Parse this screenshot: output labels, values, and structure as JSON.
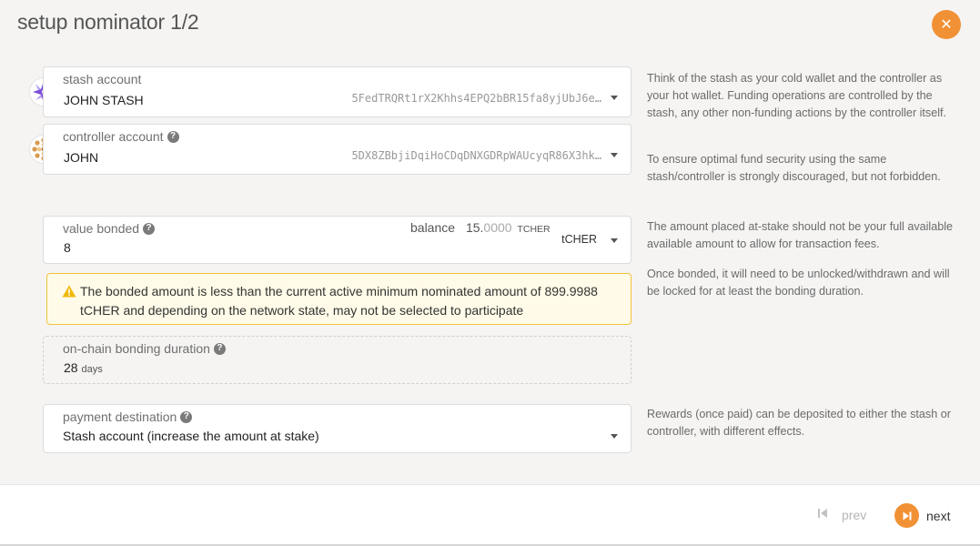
{
  "title": "setup nominator 1/2",
  "close_icon": "close-icon",
  "colors": {
    "accent": "#f19135",
    "warning_bg": "#fffbe8",
    "warning_border": "#f0c23a"
  },
  "stash": {
    "label": "stash account",
    "name": "JOHN STASH",
    "address": "5FedTRQRt1rX2Khhs4EPQ2bBR15fa8yjUbJ6e…"
  },
  "controller": {
    "label": "controller account",
    "name": "JOHN",
    "address": "5DX8ZBbjiDqiHoCDqDNXGDRpWAUcyqR86X3hk…"
  },
  "help": {
    "stash_p1": "Think of the stash as your cold wallet and the controller as your hot wallet. Funding operations are controlled by the stash, any other non-funding actions by the controller itself.",
    "stash_p2": "To ensure optimal fund security using the same stash/controller is strongly discouraged, but not forbidden.",
    "value_p1": "The amount placed at-stake should not be your full available available amount to allow for transaction fees.",
    "value_p2": "Once bonded, it will need to be unlocked/withdrawn and will be locked for at least the bonding duration.",
    "payment_p1": "Rewards (once paid) can be deposited to either the stash or controller, with different effects."
  },
  "value_bonded": {
    "label": "value bonded",
    "value": "8",
    "balance_label": "balance",
    "balance_int": "15.",
    "balance_dec": "0000",
    "balance_unit": "TCHER",
    "unit": "tCHER"
  },
  "warning": {
    "text": "The bonded amount is less than the current active minimum nominated amount of 899.9988 tCHER and depending on the network state, may not be selected to participate"
  },
  "bonding_duration": {
    "label": "on-chain bonding duration",
    "value": "28",
    "unit": "days"
  },
  "payment_destination": {
    "label": "payment destination",
    "value": "Stash account (increase the amount at stake)"
  },
  "footer": {
    "prev_label": "prev",
    "next_label": "next"
  }
}
